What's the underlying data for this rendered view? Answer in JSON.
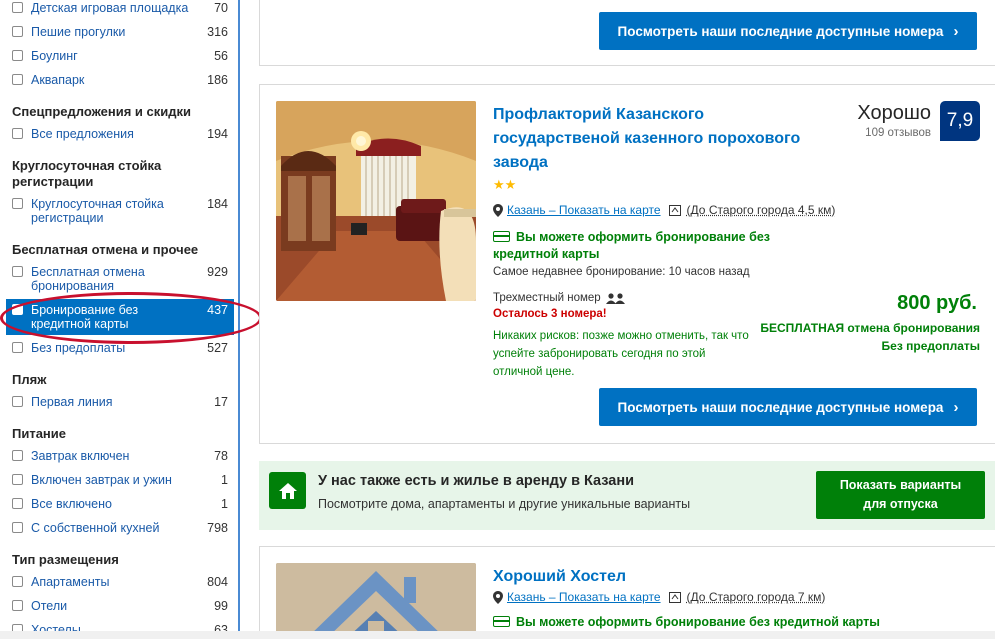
{
  "sidebar": {
    "items": [
      {
        "label": "Детская игровая площадка",
        "count": "70"
      },
      {
        "label": "Пешие прогулки",
        "count": "316"
      },
      {
        "label": "Боулинг",
        "count": "56"
      },
      {
        "label": "Аквапарк",
        "count": "186"
      },
      {
        "label": "Все предложения",
        "count": "194"
      },
      {
        "label": "Круглосуточная стойка регистрации",
        "count": "184"
      },
      {
        "label": "Бесплатная отмена бронирования",
        "count": "929"
      },
      {
        "label": "Бронирование без кредитной карты",
        "count": "437"
      },
      {
        "label": "Без предоплаты",
        "count": "527"
      },
      {
        "label": "Первая линия",
        "count": "17"
      },
      {
        "label": "Завтрак включен",
        "count": "78"
      },
      {
        "label": "Включен завтрак и ужин",
        "count": "1"
      },
      {
        "label": "Все включено",
        "count": "1"
      },
      {
        "label": "С собственной кухней",
        "count": "798"
      },
      {
        "label": "Апартаменты",
        "count": "804"
      },
      {
        "label": "Отели",
        "count": "99"
      },
      {
        "label": "Хостелы",
        "count": "63"
      }
    ],
    "headings": {
      "specials": "Спецпредложения и скидки",
      "frontdesk": "Круглосуточная стойка регистрации",
      "cancel": "Бесплатная отмена и прочее",
      "beach": "Пляж",
      "meals": "Питание",
      "type": "Тип размещения"
    }
  },
  "top_card": {
    "button_label": "Посмотреть наши последние доступные номера"
  },
  "hotel1": {
    "title": "Профлакторий Казанского государственой казенного порохового завода",
    "stars": "★★",
    "location_link": "Казань – Показать на карте",
    "distance": "(До Старого города 4,5 км)",
    "no_card_notice": "Вы можете оформить бронирование без кредитной карты",
    "recent_booking": "Самое недавнее бронирование: 10 часов назад",
    "room_type": "Трехместный номер",
    "rooms_left": "Осталось 3 номера!",
    "no_risk": "Никаких рисков: позже можно отменить, так что успейте забронировать сегодня по этой отличной цене.",
    "score_word": "Хорошо",
    "reviews": "109 отзывов",
    "score": "7,9",
    "price": "800 руб.",
    "free_cancel": "БЕСПЛАТНАЯ отмена бронирования",
    "no_prepay": "Без предоплаты",
    "button_label": "Посмотреть наши последние доступные номера"
  },
  "promo": {
    "title": "У нас также есть и жилье в аренду в Казани",
    "subtitle": "Посмотрите дома, апартаменты и другие уникальные варианты",
    "button_line1": "Показать варианты",
    "button_line2": "для отпуска"
  },
  "hotel2": {
    "title": "Хороший Хостел",
    "location_link": "Казань – Показать на карте",
    "distance": "(До Старого города 7 км)",
    "no_card_notice": "Вы можете оформить бронирование без кредитной карты"
  },
  "colors": {
    "brand_blue": "#0071c2",
    "dark_blue": "#003580",
    "green": "#008009",
    "annotation_red": "#c8102e"
  }
}
